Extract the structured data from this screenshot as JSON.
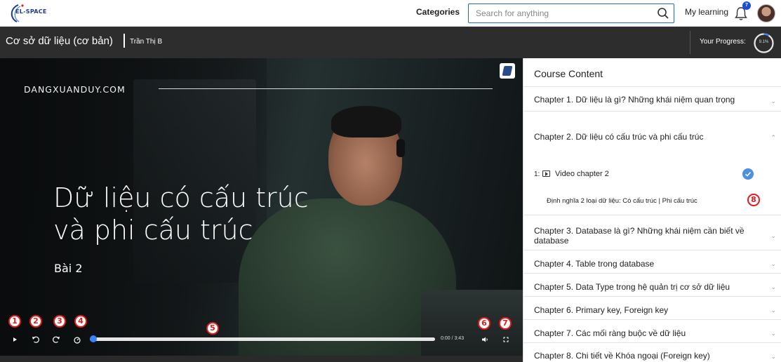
{
  "nav": {
    "logo_text": "EL-SPACE",
    "categories": "Categories",
    "search_placeholder": "Search for anything",
    "my_learning": "My learning",
    "notification_count": "7"
  },
  "course": {
    "title": "Cơ sở dữ liệu (cơ bản)",
    "author": "Trần Thị B",
    "progress_label": "Your Progress:",
    "progress_value": "9.1%",
    "progress_fraction": 0.091
  },
  "video": {
    "brand": "DANGXUANDUY.COM",
    "title_line1": "Dữ liệu có cấu trúc",
    "title_line2": "và phi cấu trúc",
    "subtitle": "Bài 2",
    "time": "0:00 / 3:43",
    "markers": [
      "1",
      "2",
      "3",
      "4",
      "5",
      "6",
      "7"
    ]
  },
  "sidebar": {
    "header": "Course Content",
    "chapters": [
      {
        "label": "Chapter 1. Dữ liệu là gì? Những khái niệm quan trọng"
      },
      {
        "label": "Chapter 2. Dữ liệu có cấu trúc và phi cấu trúc"
      },
      {
        "label": "Chapter 3. Database là gì? Những khái niệm cần biết về database"
      },
      {
        "label": "Chapter 4. Table trong database"
      },
      {
        "label": "Chapter 5. Data Type trong hệ quản trị cơ sở dữ liệu"
      },
      {
        "label": "Chapter 6. Primary key, Foreign key"
      },
      {
        "label": "Chapter 7. Các mối ràng buộc về dữ liệu"
      },
      {
        "label": "Chapter 8. Chi tiết về Khóa ngoại (Foreign key)"
      }
    ],
    "lesson": {
      "number": "1:",
      "title": "Video chapter 2",
      "description": "Định nghĩa 2 loại dữ liệu: Có cấu trúc | Phi cấu trúc",
      "marker": "8"
    }
  }
}
